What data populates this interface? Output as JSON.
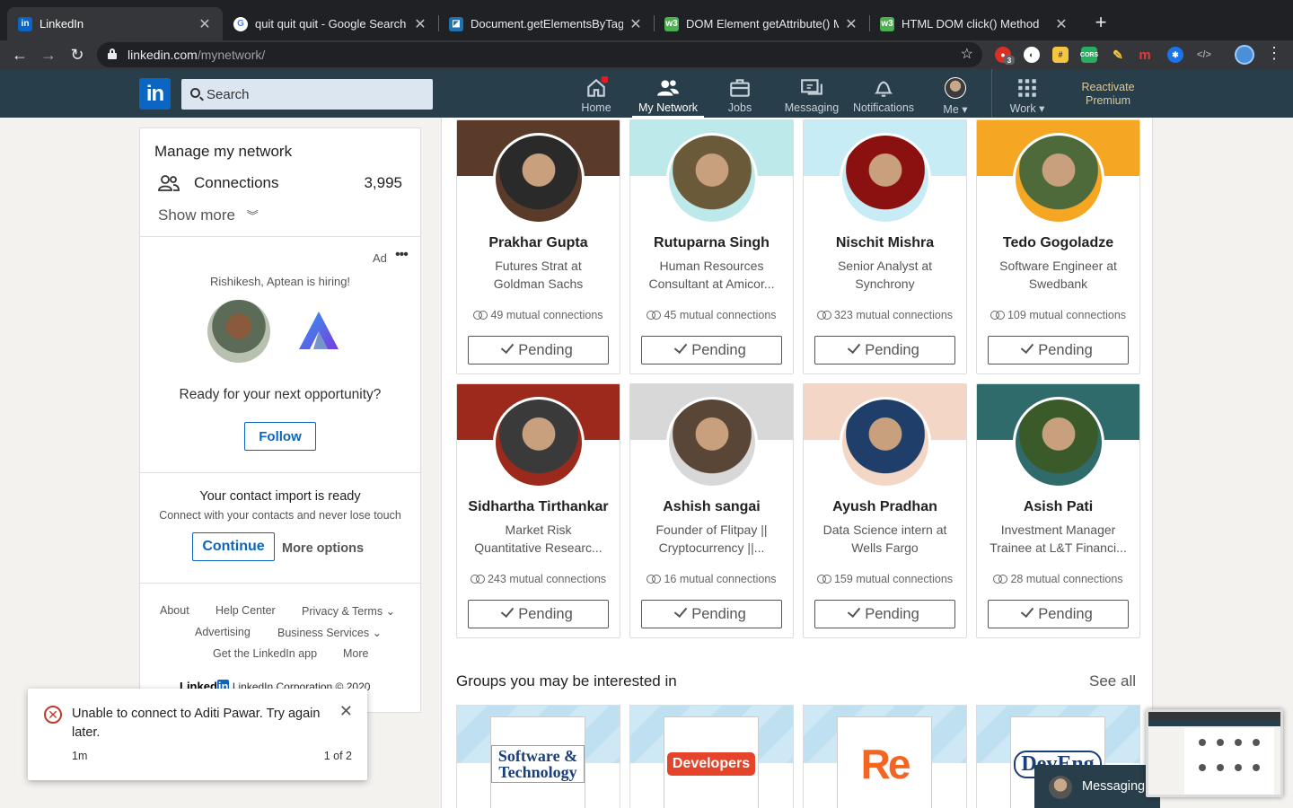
{
  "browser": {
    "tabs": [
      {
        "title": "LinkedIn",
        "active": true,
        "icon": "linkedin-icon"
      },
      {
        "title": "quit quit quit - Google Search",
        "active": false,
        "icon": "google-icon"
      },
      {
        "title": "Document.getElementsByTagN",
        "active": false,
        "icon": "mdn-icon"
      },
      {
        "title": "DOM Element getAttribute() M",
        "active": false,
        "icon": "w3schools-icon"
      },
      {
        "title": "HTML DOM click() Method",
        "active": false,
        "icon": "w3schools-icon"
      }
    ],
    "url_host": "linkedin.com",
    "url_path": "/mynetwork/",
    "extension_badge": "3"
  },
  "header": {
    "search_placeholder": "Search",
    "nav": [
      {
        "label": "Home",
        "icon": "home-icon"
      },
      {
        "label": "My Network",
        "icon": "network-icon",
        "active": true
      },
      {
        "label": "Jobs",
        "icon": "briefcase-icon"
      },
      {
        "label": "Messaging",
        "icon": "messaging-icon"
      },
      {
        "label": "Notifications",
        "icon": "bell-icon"
      },
      {
        "label": "Me",
        "icon": "avatar"
      },
      {
        "label": "Work",
        "icon": "grid-icon"
      }
    ],
    "premium_line1": "Reactivate",
    "premium_line2": "Premium"
  },
  "sidebar": {
    "title": "Manage my network",
    "connections_label": "Connections",
    "connections_count": "3,995",
    "show_more": "Show more",
    "ad": {
      "label": "Ad",
      "hiring": "Rishikesh, Aptean is hiring!",
      "ready": "Ready for your next opportunity?",
      "follow": "Follow"
    },
    "import": {
      "title": "Your contact import is ready",
      "subtitle": "Connect with your contacts and never lose touch",
      "continue": "Continue",
      "more_options": "More options"
    },
    "footer": {
      "about": "About",
      "help": "Help Center",
      "privacy": "Privacy & Terms",
      "advertising": "Advertising",
      "business": "Business Services",
      "app": "Get the LinkedIn app",
      "more": "More",
      "copyright": "LinkedIn Corporation © 2020"
    }
  },
  "people": [
    {
      "name": "Prakhar Gupta",
      "line1": "Futures Strat at",
      "line2": "Goldman Sachs",
      "mutual": "49 mutual connections",
      "action": "Pending",
      "cover": "#5a3b2a",
      "avatar": "#2a2a2a"
    },
    {
      "name": "Rutuparna Singh",
      "line1": "Human Resources",
      "line2": "Consultant at Amicor...",
      "mutual": "45 mutual connections",
      "action": "Pending",
      "cover": "#bde9ea",
      "avatar": "#6b5a3a"
    },
    {
      "name": "Nischit Mishra",
      "line1": "Senior Analyst at",
      "line2": "Synchrony",
      "mutual": "323 mutual connections",
      "action": "Pending",
      "cover": "#c8ecf5",
      "avatar": "#8b1010"
    },
    {
      "name": "Tedo Gogoladze",
      "line1": "Software Engineer at",
      "line2": "Swedbank",
      "mutual": "109 mutual connections",
      "action": "Pending",
      "cover": "#f5a623",
      "avatar": "#4f6a3a"
    },
    {
      "name": "Sidhartha Tirthankar",
      "line1": "Market Risk",
      "line2": "Quantitative Researc...",
      "mutual": "243 mutual connections",
      "action": "Pending",
      "cover": "#9b2a1c",
      "avatar": "#3a3a3a"
    },
    {
      "name": "Ashish sangai",
      "line1": "Founder of Flitpay ||",
      "line2": "Cryptocurrency ||...",
      "mutual": "16 mutual connections",
      "action": "Pending",
      "cover": "#d8d8d8",
      "avatar": "#5a4636"
    },
    {
      "name": "Ayush Pradhan",
      "line1": "Data Science intern at",
      "line2": "Wells Fargo",
      "mutual": "159 mutual connections",
      "action": "Pending",
      "cover": "#f3d6c6",
      "avatar": "#1f3f6a"
    },
    {
      "name": "Asish Pati",
      "line1": "Investment Manager",
      "line2": "Trainee at L&T Financi...",
      "mutual": "28 mutual connections",
      "action": "Pending",
      "cover": "#2f6b6a",
      "avatar": "#3b5a2a"
    }
  ],
  "groups": {
    "title": "Groups you may be interested in",
    "see_all": "See all",
    "logos": [
      "Software & Technology",
      "Developers",
      "Re",
      "DevEng"
    ]
  },
  "toast": {
    "message": "Unable to connect to Aditi Pawar. Try again later.",
    "time": "1m",
    "count": "1 of 2"
  },
  "messaging": {
    "label": "Messaging"
  }
}
